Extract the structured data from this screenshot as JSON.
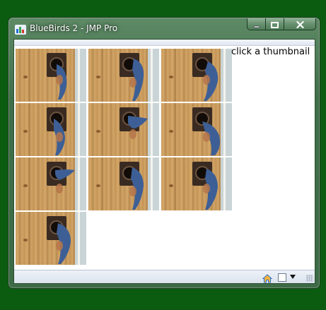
{
  "window": {
    "title": "BlueBirds 2 - JMP Pro"
  },
  "icons": {
    "app": "jmp-app-icon",
    "minimize": "minimize-icon",
    "maximize": "maximize-icon",
    "close": "close-icon",
    "home": "home-icon",
    "checkbox": "checkbox-icon",
    "dropdown": "chevron-down-icon",
    "grip": "resize-grip-icon"
  },
  "content": {
    "caption": "click a thumbnail",
    "thumbnail_count": 10
  },
  "colors": {
    "desktop": "#0b5c10",
    "frame": "#3f6f48",
    "bird_blue": "#3d5f96",
    "bird_orange": "#b6764a"
  }
}
